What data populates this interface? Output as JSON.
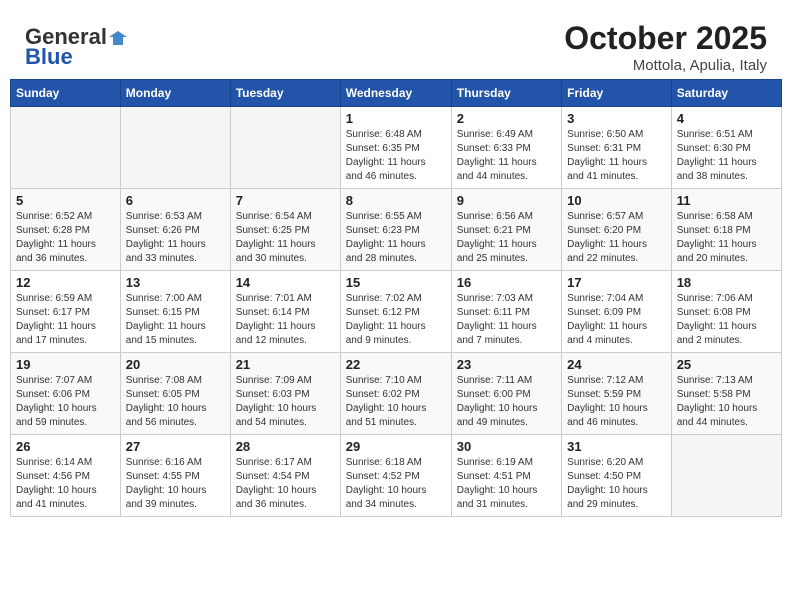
{
  "header": {
    "logo_general": "General",
    "logo_blue": "Blue",
    "month": "October 2025",
    "location": "Mottola, Apulia, Italy"
  },
  "weekdays": [
    "Sunday",
    "Monday",
    "Tuesday",
    "Wednesday",
    "Thursday",
    "Friday",
    "Saturday"
  ],
  "weeks": [
    [
      {
        "day": "",
        "info": ""
      },
      {
        "day": "",
        "info": ""
      },
      {
        "day": "",
        "info": ""
      },
      {
        "day": "1",
        "info": "Sunrise: 6:48 AM\nSunset: 6:35 PM\nDaylight: 11 hours\nand 46 minutes."
      },
      {
        "day": "2",
        "info": "Sunrise: 6:49 AM\nSunset: 6:33 PM\nDaylight: 11 hours\nand 44 minutes."
      },
      {
        "day": "3",
        "info": "Sunrise: 6:50 AM\nSunset: 6:31 PM\nDaylight: 11 hours\nand 41 minutes."
      },
      {
        "day": "4",
        "info": "Sunrise: 6:51 AM\nSunset: 6:30 PM\nDaylight: 11 hours\nand 38 minutes."
      }
    ],
    [
      {
        "day": "5",
        "info": "Sunrise: 6:52 AM\nSunset: 6:28 PM\nDaylight: 11 hours\nand 36 minutes."
      },
      {
        "day": "6",
        "info": "Sunrise: 6:53 AM\nSunset: 6:26 PM\nDaylight: 11 hours\nand 33 minutes."
      },
      {
        "day": "7",
        "info": "Sunrise: 6:54 AM\nSunset: 6:25 PM\nDaylight: 11 hours\nand 30 minutes."
      },
      {
        "day": "8",
        "info": "Sunrise: 6:55 AM\nSunset: 6:23 PM\nDaylight: 11 hours\nand 28 minutes."
      },
      {
        "day": "9",
        "info": "Sunrise: 6:56 AM\nSunset: 6:21 PM\nDaylight: 11 hours\nand 25 minutes."
      },
      {
        "day": "10",
        "info": "Sunrise: 6:57 AM\nSunset: 6:20 PM\nDaylight: 11 hours\nand 22 minutes."
      },
      {
        "day": "11",
        "info": "Sunrise: 6:58 AM\nSunset: 6:18 PM\nDaylight: 11 hours\nand 20 minutes."
      }
    ],
    [
      {
        "day": "12",
        "info": "Sunrise: 6:59 AM\nSunset: 6:17 PM\nDaylight: 11 hours\nand 17 minutes."
      },
      {
        "day": "13",
        "info": "Sunrise: 7:00 AM\nSunset: 6:15 PM\nDaylight: 11 hours\nand 15 minutes."
      },
      {
        "day": "14",
        "info": "Sunrise: 7:01 AM\nSunset: 6:14 PM\nDaylight: 11 hours\nand 12 minutes."
      },
      {
        "day": "15",
        "info": "Sunrise: 7:02 AM\nSunset: 6:12 PM\nDaylight: 11 hours\nand 9 minutes."
      },
      {
        "day": "16",
        "info": "Sunrise: 7:03 AM\nSunset: 6:11 PM\nDaylight: 11 hours\nand 7 minutes."
      },
      {
        "day": "17",
        "info": "Sunrise: 7:04 AM\nSunset: 6:09 PM\nDaylight: 11 hours\nand 4 minutes."
      },
      {
        "day": "18",
        "info": "Sunrise: 7:06 AM\nSunset: 6:08 PM\nDaylight: 11 hours\nand 2 minutes."
      }
    ],
    [
      {
        "day": "19",
        "info": "Sunrise: 7:07 AM\nSunset: 6:06 PM\nDaylight: 10 hours\nand 59 minutes."
      },
      {
        "day": "20",
        "info": "Sunrise: 7:08 AM\nSunset: 6:05 PM\nDaylight: 10 hours\nand 56 minutes."
      },
      {
        "day": "21",
        "info": "Sunrise: 7:09 AM\nSunset: 6:03 PM\nDaylight: 10 hours\nand 54 minutes."
      },
      {
        "day": "22",
        "info": "Sunrise: 7:10 AM\nSunset: 6:02 PM\nDaylight: 10 hours\nand 51 minutes."
      },
      {
        "day": "23",
        "info": "Sunrise: 7:11 AM\nSunset: 6:00 PM\nDaylight: 10 hours\nand 49 minutes."
      },
      {
        "day": "24",
        "info": "Sunrise: 7:12 AM\nSunset: 5:59 PM\nDaylight: 10 hours\nand 46 minutes."
      },
      {
        "day": "25",
        "info": "Sunrise: 7:13 AM\nSunset: 5:58 PM\nDaylight: 10 hours\nand 44 minutes."
      }
    ],
    [
      {
        "day": "26",
        "info": "Sunrise: 6:14 AM\nSunset: 4:56 PM\nDaylight: 10 hours\nand 41 minutes."
      },
      {
        "day": "27",
        "info": "Sunrise: 6:16 AM\nSunset: 4:55 PM\nDaylight: 10 hours\nand 39 minutes."
      },
      {
        "day": "28",
        "info": "Sunrise: 6:17 AM\nSunset: 4:54 PM\nDaylight: 10 hours\nand 36 minutes."
      },
      {
        "day": "29",
        "info": "Sunrise: 6:18 AM\nSunset: 4:52 PM\nDaylight: 10 hours\nand 34 minutes."
      },
      {
        "day": "30",
        "info": "Sunrise: 6:19 AM\nSunset: 4:51 PM\nDaylight: 10 hours\nand 31 minutes."
      },
      {
        "day": "31",
        "info": "Sunrise: 6:20 AM\nSunset: 4:50 PM\nDaylight: 10 hours\nand 29 minutes."
      },
      {
        "day": "",
        "info": ""
      }
    ]
  ]
}
